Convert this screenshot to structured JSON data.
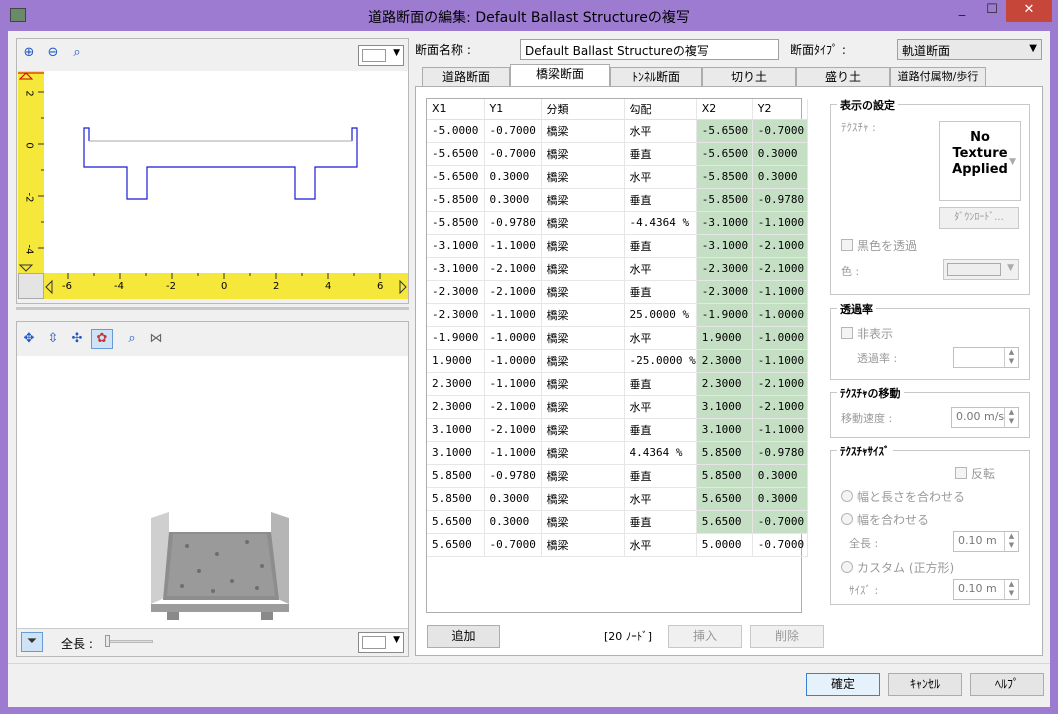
{
  "window": {
    "title": "道路断面の編集: Default Ballast Structureの複写",
    "min": "_",
    "max": "☐",
    "close": "✕"
  },
  "section_name_label": "断面名称 :",
  "section_name_value": "Default Ballast Structureの複写",
  "section_type_label": "断面ﾀｲﾌﾟ :",
  "section_type_value": "軌道断面",
  "tabs": [
    "道路断面",
    "橋梁断面",
    "ﾄﾝﾈﾙ断面",
    "切り土",
    "盛り土",
    "道路付属物/歩行"
  ],
  "active_tab": "橋梁断面",
  "ruler_v": [
    "2",
    "0",
    "-2",
    "-4"
  ],
  "ruler_h": [
    "-6",
    "-4",
    "-2",
    "0",
    "2",
    "4",
    "6"
  ],
  "table": {
    "headers": [
      "X1",
      "Y1",
      "分類",
      "勾配",
      "X2",
      "Y2"
    ],
    "rows": [
      [
        "-5.0000",
        "-0.7000",
        "橋梁",
        "水平",
        "-5.6500",
        "-0.7000"
      ],
      [
        "-5.6500",
        "-0.7000",
        "橋梁",
        "垂直",
        "-5.6500",
        "0.3000"
      ],
      [
        "-5.6500",
        "0.3000",
        "橋梁",
        "水平",
        "-5.8500",
        "0.3000"
      ],
      [
        "-5.8500",
        "0.3000",
        "橋梁",
        "垂直",
        "-5.8500",
        "-0.9780"
      ],
      [
        "-5.8500",
        "-0.9780",
        "橋梁",
        "-4.4364 %",
        "-3.1000",
        "-1.1000"
      ],
      [
        "-3.1000",
        "-1.1000",
        "橋梁",
        "垂直",
        "-3.1000",
        "-2.1000"
      ],
      [
        "-3.1000",
        "-2.1000",
        "橋梁",
        "水平",
        "-2.3000",
        "-2.1000"
      ],
      [
        "-2.3000",
        "-2.1000",
        "橋梁",
        "垂直",
        "-2.3000",
        "-1.1000"
      ],
      [
        "-2.3000",
        "-1.1000",
        "橋梁",
        "25.0000 %",
        "-1.9000",
        "-1.0000"
      ],
      [
        "-1.9000",
        "-1.0000",
        "橋梁",
        "水平",
        "1.9000",
        "-1.0000"
      ],
      [
        "1.9000",
        "-1.0000",
        "橋梁",
        "-25.0000 %",
        "2.3000",
        "-1.1000"
      ],
      [
        "2.3000",
        "-1.1000",
        "橋梁",
        "垂直",
        "2.3000",
        "-2.1000"
      ],
      [
        "2.3000",
        "-2.1000",
        "橋梁",
        "水平",
        "3.1000",
        "-2.1000"
      ],
      [
        "3.1000",
        "-2.1000",
        "橋梁",
        "垂直",
        "3.1000",
        "-1.1000"
      ],
      [
        "3.1000",
        "-1.1000",
        "橋梁",
        "4.4364 %",
        "5.8500",
        "-0.9780"
      ],
      [
        "5.8500",
        "-0.9780",
        "橋梁",
        "垂直",
        "5.8500",
        "0.3000"
      ],
      [
        "5.8500",
        "0.3000",
        "橋梁",
        "水平",
        "5.6500",
        "0.3000"
      ],
      [
        "5.6500",
        "0.3000",
        "橋梁",
        "垂直",
        "5.6500",
        "-0.7000"
      ],
      [
        "5.6500",
        "-0.7000",
        "橋梁",
        "水平",
        "5.0000",
        "-0.7000"
      ]
    ]
  },
  "add_label": "追加",
  "node_count": "[20 ﾉｰﾄﾞ]",
  "insert_label": "挿入",
  "delete_label": "削除",
  "display": {
    "legend": "表示の設定",
    "texture_label": "ﾃｸｽﾁｬ :",
    "texture_preview": [
      "No",
      "Texture",
      "Applied"
    ],
    "download_label": "ﾀﾞｳﾝﾛｰﾄﾞ...",
    "black_transparent": "黒色を透過",
    "color_label": "色 :"
  },
  "transparency": {
    "legend": "透過率",
    "hide_label": "非表示",
    "rate_label": "透過率 :"
  },
  "texture_move": {
    "legend": "ﾃｸｽﾁｬの移動",
    "speed_label": "移動速度 :",
    "speed_value": "0.00 m/s"
  },
  "texture_size": {
    "legend": "ﾃｸｽﾁｬｻｲｽﾞ",
    "invert_label": "反転",
    "fit_width_length": "幅と長さを合わせる",
    "fit_width": "幅を合わせる",
    "length_label": "全長 :",
    "length_value": "0.10 m",
    "custom_label": "カスタム (正方形)",
    "size_label": "ｻｲｽﾞ :",
    "size_value": "0.10 m"
  },
  "length_slider_label": "全長 :",
  "ok_label": "確定",
  "cancel_label": "ｷｬﾝｾﾙ",
  "help_label": "ﾍﾙﾌﾟ",
  "colors": {
    "title_bg": "#9c7bd1",
    "green_cell": "#c4dfc4",
    "ruler": "#f5e83a",
    "profile_line": "#1a1ad6"
  }
}
